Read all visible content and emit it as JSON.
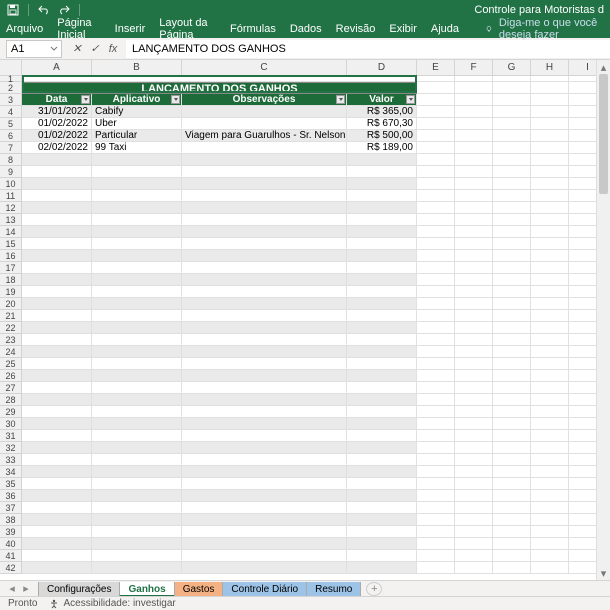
{
  "titlebar": {
    "title": "Controle para Motoristas d"
  },
  "ribbon": {
    "tabs": [
      "Arquivo",
      "Página Inicial",
      "Inserir",
      "Layout da Página",
      "Fórmulas",
      "Dados",
      "Revisão",
      "Exibir",
      "Ajuda"
    ],
    "tell_me": "Diga-me o que você deseja fazer"
  },
  "formula_bar": {
    "namebox": "A1",
    "formula": "LANÇAMENTO DOS GANHOS"
  },
  "columns": [
    "A",
    "B",
    "C",
    "D",
    "E",
    "F",
    "G",
    "H",
    "I"
  ],
  "row_count": 42,
  "sheet": {
    "title_merged": "LANÇAMENTO DOS GANHOS",
    "headers": {
      "A": "Data",
      "B": "Aplicativo",
      "C": "Observações",
      "D": "Valor"
    },
    "rows": [
      {
        "A": "31/01/2022",
        "B": "Cabify",
        "C": "",
        "D": "R$ 365,00"
      },
      {
        "A": "01/02/2022",
        "B": "Uber",
        "C": "",
        "D": "R$ 670,30"
      },
      {
        "A": "01/02/2022",
        "B": "Particular",
        "C": "Viagem para Guarulhos - Sr. Nelson",
        "D": "R$ 500,00"
      },
      {
        "A": "02/02/2022",
        "B": "99 Taxi",
        "C": "",
        "D": "R$ 189,00"
      }
    ]
  },
  "sheet_tabs": [
    {
      "label": "Configurações",
      "style": "config"
    },
    {
      "label": "Ganhos",
      "style": "active"
    },
    {
      "label": "Gastos",
      "style": "gastos"
    },
    {
      "label": "Controle Diário",
      "style": "contr"
    },
    {
      "label": "Resumo",
      "style": "res"
    }
  ],
  "statusbar": {
    "ready": "Pronto",
    "accessibility": "Acessibilidade: investigar"
  },
  "chart_data": {
    "type": "table",
    "title": "LANÇAMENTO DOS GANHOS",
    "columns": [
      "Data",
      "Aplicativo",
      "Observações",
      "Valor"
    ],
    "rows": [
      [
        "31/01/2022",
        "Cabify",
        "",
        "R$ 365,00"
      ],
      [
        "01/02/2022",
        "Uber",
        "",
        "R$ 670,30"
      ],
      [
        "01/02/2022",
        "Particular",
        "Viagem para Guarulhos - Sr. Nelson",
        "R$ 500,00"
      ],
      [
        "02/02/2022",
        "99 Taxi",
        "",
        "R$ 189,00"
      ]
    ]
  }
}
